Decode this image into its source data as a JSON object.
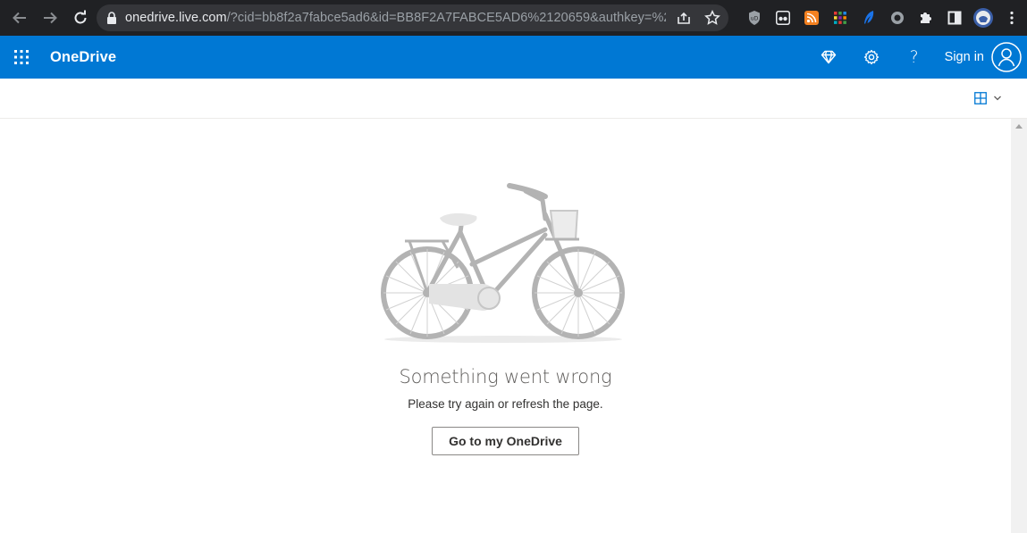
{
  "browser": {
    "url_host": "onedrive.live.com",
    "url_rest": "/?cid=bb8f2a7fabce5ad6&id=BB8F2A7FABCE5AD6%2120659&authkey=%21A..."
  },
  "header": {
    "brand": "OneDrive",
    "signin_label": "Sign in",
    "help_label": "?"
  },
  "error": {
    "title": "Something went wrong",
    "subtitle": "Please try again or refresh the page.",
    "button_label": "Go to my OneDrive"
  },
  "colors": {
    "brand_blue": "#0078d4",
    "chrome_dark": "#202124"
  }
}
